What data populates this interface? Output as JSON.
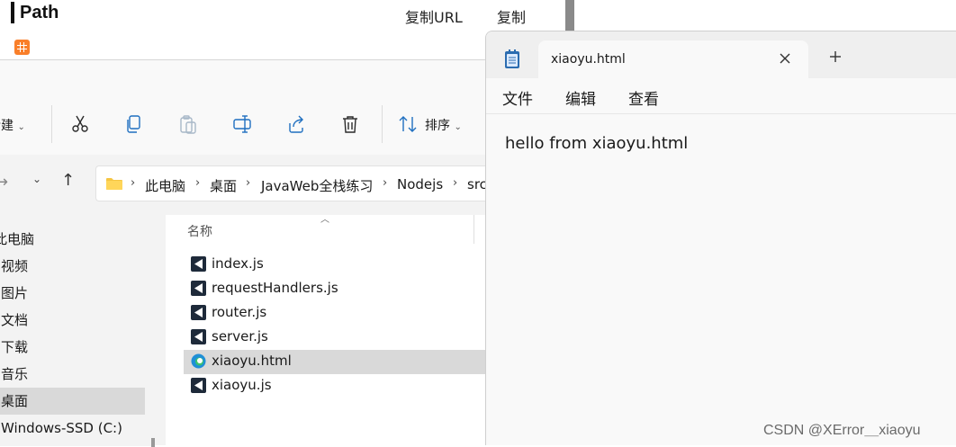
{
  "web_page": {
    "title": "Path",
    "copy_url_label": "复制URL",
    "copy_label": "复制",
    "grid_icon": "grid-icon"
  },
  "explorer": {
    "toolbar": {
      "new_label": "新建",
      "sort_label": "排序",
      "icons": [
        "cut-icon",
        "copy-icon",
        "paste-icon",
        "rename-icon",
        "share-icon",
        "delete-icon",
        "sort-icon"
      ]
    },
    "breadcrumb": [
      "此电脑",
      "桌面",
      "JavaWeb全栈练习",
      "Nodejs",
      "src"
    ],
    "sidebar": {
      "items": [
        "此电脑",
        "视频",
        "图片",
        "文档",
        "下载",
        "音乐",
        "桌面",
        "Windows-SSD (C:)"
      ],
      "selected": "桌面"
    },
    "columns": {
      "name": "名称"
    },
    "files": [
      {
        "name": "index.js",
        "icon": "js-file-icon"
      },
      {
        "name": "requestHandlers.js",
        "icon": "js-file-icon"
      },
      {
        "name": "router.js",
        "icon": "js-file-icon"
      },
      {
        "name": "server.js",
        "icon": "js-file-icon"
      },
      {
        "name": "xiaoyu.html",
        "icon": "edge-html-icon",
        "selected": true
      },
      {
        "name": "xiaoyu.js",
        "icon": "js-file-icon"
      }
    ]
  },
  "notepad": {
    "tab_title": "xiaoyu.html",
    "menu": [
      "文件",
      "编辑",
      "查看"
    ],
    "content": "hello from xiaoyu.html"
  },
  "watermark": "CSDN @XError＿xiaoyu"
}
